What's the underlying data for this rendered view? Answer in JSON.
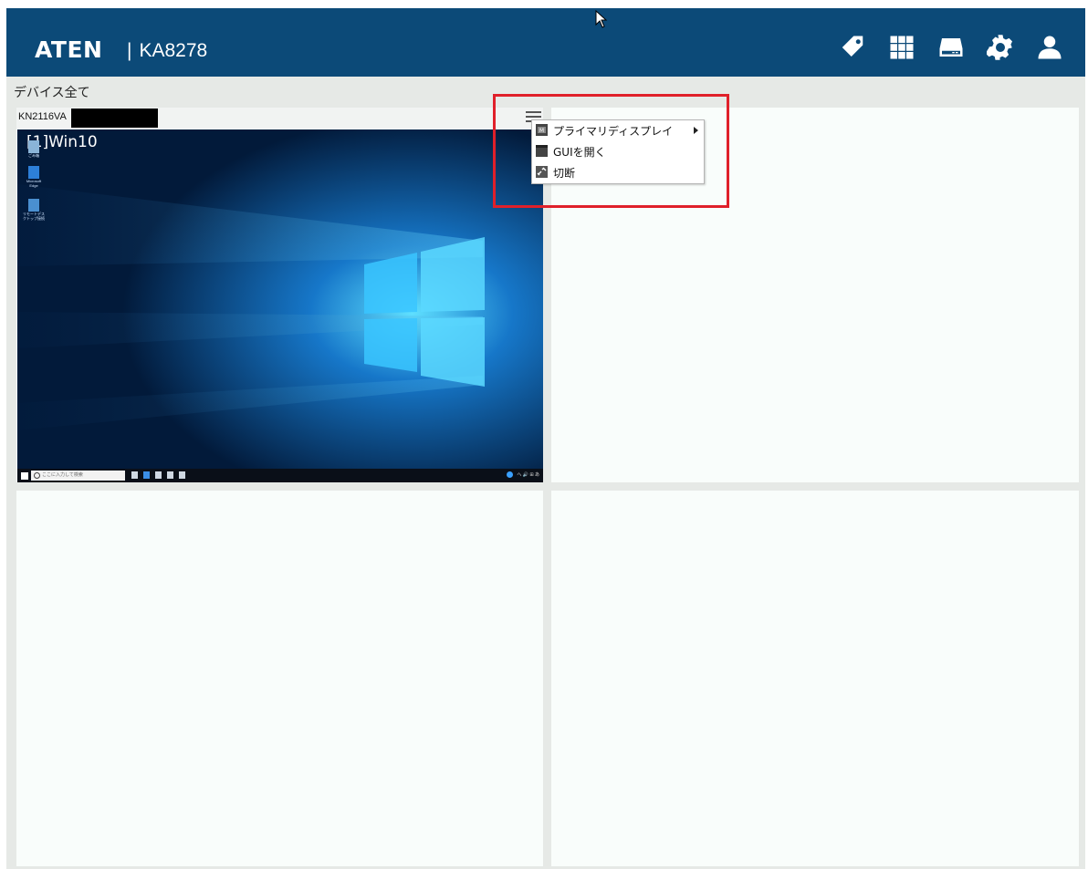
{
  "header": {
    "brand": "ATEN",
    "separator": "|",
    "model": "KA8278",
    "icons": [
      "tag-icon",
      "grid-icon",
      "storage-icon",
      "gear-icon",
      "user-icon"
    ],
    "background_color": "#0c4a78"
  },
  "section": {
    "title": "デバイス全て"
  },
  "panels": [
    {
      "name": "KN2116VA",
      "screen": {
        "label": "[1]Win10",
        "desktop_icons": [
          "ごみ箱",
          "Microsoft Edge",
          "リモートデスクトップ接続"
        ],
        "taskbar_search_placeholder": "ここに入力して検索",
        "tray_text": "へ 🔊 ⊞ あ"
      }
    },
    {
      "name": ""
    },
    {
      "name": ""
    },
    {
      "name": ""
    }
  ],
  "context_menu": {
    "items": [
      {
        "label": "プライマリディスプレイ",
        "icon": "display-icon",
        "has_submenu": true
      },
      {
        "label": "GUIを開く",
        "icon": "window-icon",
        "has_submenu": false
      },
      {
        "label": "切断",
        "icon": "disconnect-icon",
        "has_submenu": false
      }
    ]
  },
  "colors": {
    "highlight_box": "#e0202a"
  }
}
